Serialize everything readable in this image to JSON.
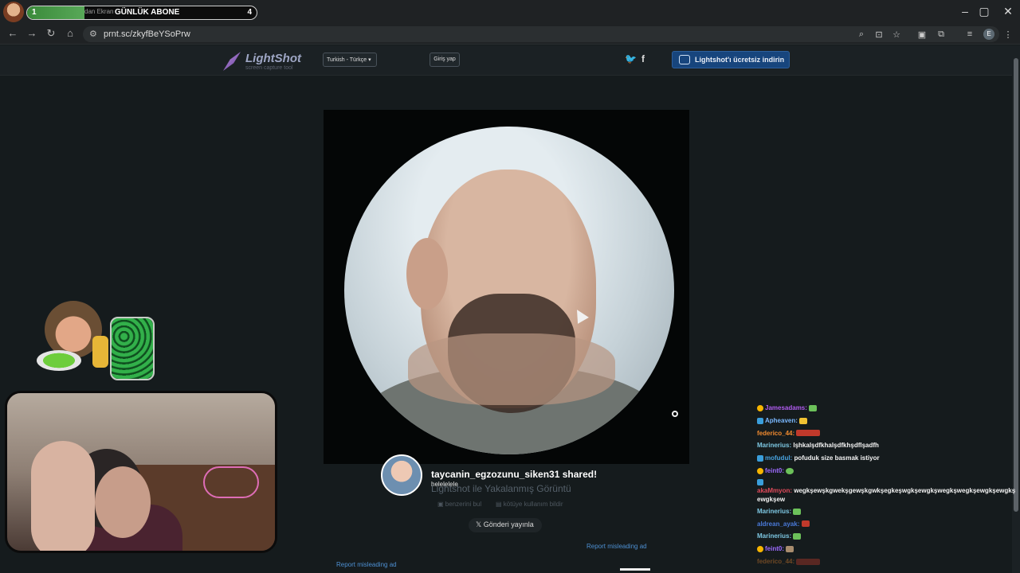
{
  "tabbar": {
    "progress_start": "1",
    "progress_end": "4",
    "progress_title": "GÜNLÜK ABONE",
    "progress_faint_text": "dan Ekran",
    "progress_fraction": 0.25,
    "window_controls": [
      "–",
      "▢",
      "✕"
    ]
  },
  "addressbar": {
    "url": "prnt.sc/zkyfBeYSoPrw"
  },
  "lightshot": {
    "logo_name": "LightShot",
    "logo_tag": "screen capture tool",
    "language": "Turkish - Türkçe",
    "login": "Giriş yap",
    "download_button": "Lightshot'ı ücretsiz indirin",
    "social": [
      "twitter",
      "facebook"
    ]
  },
  "image_meta": {
    "sharer_text": "taycanin_egzozunu_siken31 shared!",
    "sharer_sub": "helelelele",
    "caption": "Lightshot ile Yakalanmış Görüntü",
    "similar": "benzerini bul",
    "abuse": "kötüye kullanım bildir",
    "tweet": "Gönderi yayınla",
    "report_ad_1": "Report misleading ad",
    "report_ad_2": "Report misleading ad"
  },
  "chat": [
    {
      "nick": "Jamesadams:",
      "color": "#b05cf0",
      "msg": ""
    },
    {
      "nick": "Apheaven:",
      "color": "#7ab8ff",
      "msg": ""
    },
    {
      "nick": "federico_44:",
      "color": "#f08a2f",
      "msg": ""
    },
    {
      "nick": "Marinerius:",
      "color": "#7ec8e3",
      "msg": "lşhkalşdfkhalşdfkhşdflşadfh"
    },
    {
      "nick": "mofudul:",
      "color": "#48a3e0",
      "msg": "pofuduk size basmak istiyor"
    },
    {
      "nick": "feint0:",
      "color": "#9d6bff",
      "msg": ""
    },
    {
      "nick": "akaMmyon:",
      "color": "#e04a5a",
      "msg": "wegkşewşkgwekşgewşkgwkşegkeşwgkşewgkşwegkşwegkşewgkşewgkşewgkşew"
    },
    {
      "nick": "Marinerius:",
      "color": "#7ec8e3",
      "msg": ""
    },
    {
      "nick": "aldrean_ayak:",
      "color": "#4a7ad9",
      "msg": ""
    },
    {
      "nick": "Marinerius:",
      "color": "#7ec8e3",
      "msg": ""
    },
    {
      "nick": "feint0:",
      "color": "#9d6bff",
      "msg": ""
    },
    {
      "nick": "federico_44:",
      "color": "#f08a2f",
      "msg": ""
    }
  ]
}
